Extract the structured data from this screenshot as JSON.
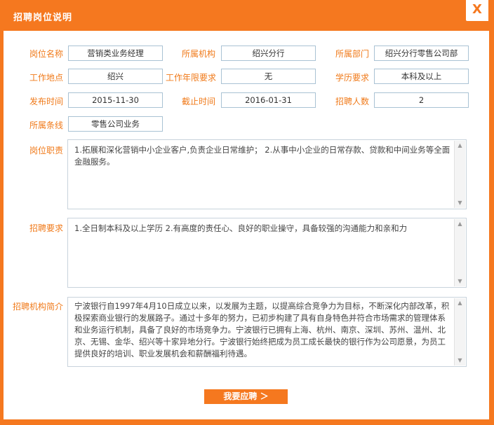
{
  "dialog": {
    "title": "招聘岗位说明",
    "close_label": "X"
  },
  "fields": {
    "position_name": {
      "label": "岗位名称",
      "value": "营销类业务经理"
    },
    "org": {
      "label": "所属机构",
      "value": "绍兴分行"
    },
    "dept": {
      "label": "所属部门",
      "value": "绍兴分行零售公司部"
    },
    "location": {
      "label": "工作地点",
      "value": "绍兴"
    },
    "experience": {
      "label": "工作年限要求",
      "value": "无"
    },
    "education": {
      "label": "学历要求",
      "value": "本科及以上"
    },
    "publish_date": {
      "label": "发布时间",
      "value": "2015-11-30"
    },
    "deadline": {
      "label": "截止时间",
      "value": "2016-01-31"
    },
    "headcount": {
      "label": "招聘人数",
      "value": "2"
    },
    "line": {
      "label": "所属条线",
      "value": "零售公司业务"
    }
  },
  "duties": {
    "label": "岗位职责",
    "text": "1.拓展和深化营销中小企业客户,负责企业日常维护； 2.从事中小企业的日常存款、贷款和中间业务等全面金融服务。"
  },
  "requirements": {
    "label": "招聘要求",
    "text": "1.全日制本科及以上学历 2.有高度的责任心、良好的职业操守，具备较强的沟通能力和亲和力"
  },
  "intro": {
    "label": "招聘机构简介",
    "text": "宁波银行自1997年4月10日成立以来，以发展为主题，以提高综合竞争力为目标，不断深化内部改革，积极探索商业银行的发展路子。通过十多年的努力，已初步构建了具有自身特色并符合市场需求的管理体系和业务运行机制，具备了良好的市场竞争力。宁波银行已拥有上海、杭州、南京、深圳、苏州、温州、北京、无锡、金华、绍兴等十家异地分行。宁波银行始终把成为员工成长最快的银行作为公司愿景，为员工提供良好的培训、职业发展机会和薪酬福利待遇。"
  },
  "apply_button": "我要应聘 ＞",
  "colors": {
    "accent": "#f5781f",
    "label": "#f07a1a",
    "border": "#a9c2d4"
  }
}
